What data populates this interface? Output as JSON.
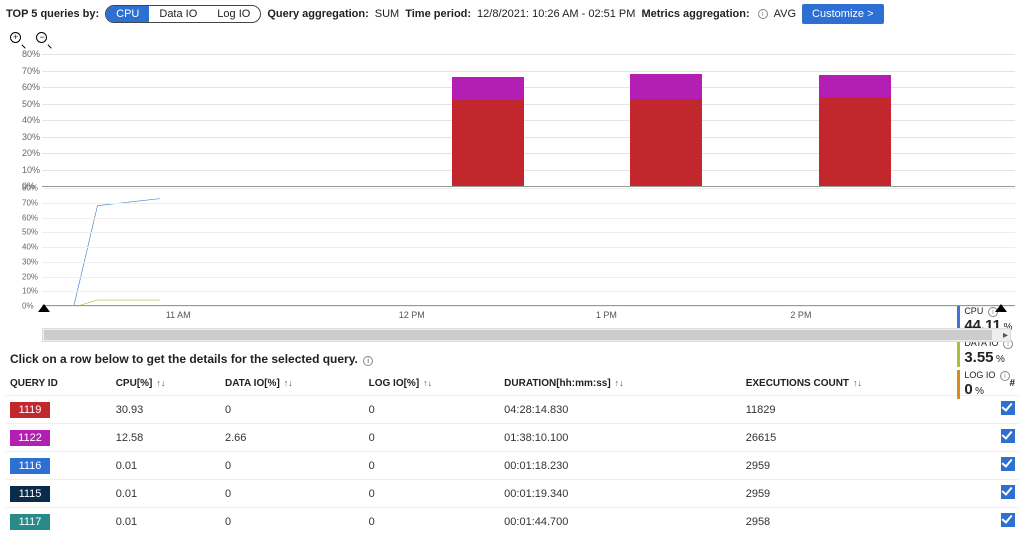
{
  "topbar": {
    "label_top5": "TOP 5 queries by:",
    "pills": [
      "CPU",
      "Data IO",
      "Log IO"
    ],
    "active_pill_index": 0,
    "query_agg_label": "Query aggregation:",
    "query_agg_value": "SUM",
    "time_period_label": "Time period:",
    "time_period_value": "12/8/2021: 10:26 AM - 02:51 PM",
    "metrics_agg_label": "Metrics aggregation:",
    "metrics_agg_value": "AVG",
    "customize_btn": "Customize >"
  },
  "chart_data": [
    {
      "type": "bar",
      "xlabel": "",
      "ylabel": "",
      "ylim": [
        0,
        80
      ],
      "y_ticks": [
        0,
        10,
        20,
        30,
        40,
        50,
        60,
        70,
        80
      ],
      "categories": [
        "12 PM",
        "1 PM",
        "2 PM"
      ],
      "x_positions_pct": [
        45,
        63,
        82
      ],
      "series": [
        {
          "name": "1122",
          "color": "#b31fb3",
          "values": [
            14,
            15,
            13
          ]
        },
        {
          "name": "1119",
          "color": "#c1272d",
          "values": [
            52,
            53,
            54
          ]
        }
      ],
      "totals_approx": [
        66,
        68,
        67
      ]
    },
    {
      "type": "line",
      "xlabel": "",
      "ylabel": "",
      "ylim": [
        0,
        80
      ],
      "y_ticks": [
        0,
        10,
        20,
        30,
        40,
        50,
        60,
        70,
        80
      ],
      "x_ticks": [
        "11 AM",
        "12 PM",
        "1 PM",
        "2 PM"
      ],
      "x_tick_positions_pct": [
        14,
        38,
        58,
        78
      ],
      "series": [
        {
          "name": "CPU",
          "color": "#3a77d0",
          "points_pct": [
            [
              3,
              100
            ],
            [
              27,
              100
            ],
            [
              47,
              15
            ],
            [
              100,
              9
            ]
          ]
        },
        {
          "name": "DATA IO",
          "color": "#a6c23a",
          "points_pct": [
            [
              3,
              100
            ],
            [
              30,
              100
            ],
            [
              47,
              95
            ],
            [
              100,
              95
            ]
          ]
        },
        {
          "name": "LOG IO",
          "color": "#d98c1a",
          "points_pct": [
            [
              3,
              100
            ],
            [
              100,
              100
            ]
          ]
        }
      ]
    }
  ],
  "legend": {
    "cpu": {
      "label": "CPU",
      "value": "44.11",
      "suffix": "%",
      "color": "#3a77d0"
    },
    "dataio": {
      "label": "DATA IO",
      "value": "3.55",
      "suffix": "%",
      "color": "#a6c23a"
    },
    "logio": {
      "label": "LOG IO",
      "value": "0",
      "suffix": "%",
      "color": "#d98c1a"
    }
  },
  "helper_text": "Click on a row below to get the details for the selected query.",
  "table": {
    "headers": [
      "QUERY ID",
      "CPU[%]",
      "DATA IO[%]",
      "LOG IO[%]",
      "DURATION[hh:mm:ss]",
      "EXECUTIONS COUNT",
      "#"
    ],
    "rows": [
      {
        "id": "1119",
        "color": "#c1272d",
        "cpu": "30.93",
        "dataio": "0",
        "logio": "0",
        "duration": "04:28:14.830",
        "exec": "11829"
      },
      {
        "id": "1122",
        "color": "#b31fb3",
        "cpu": "12.58",
        "dataio": "2.66",
        "logio": "0",
        "duration": "01:38:10.100",
        "exec": "26615"
      },
      {
        "id": "1116",
        "color": "#2d6fd2",
        "cpu": "0.01",
        "dataio": "0",
        "logio": "0",
        "duration": "00:01:18.230",
        "exec": "2959"
      },
      {
        "id": "1115",
        "color": "#0b2b4a",
        "cpu": "0.01",
        "dataio": "0",
        "logio": "0",
        "duration": "00:01:19.340",
        "exec": "2959"
      },
      {
        "id": "1117",
        "color": "#2a8a8a",
        "cpu": "0.01",
        "dataio": "0",
        "logio": "0",
        "duration": "00:01:44.700",
        "exec": "2958"
      }
    ]
  }
}
